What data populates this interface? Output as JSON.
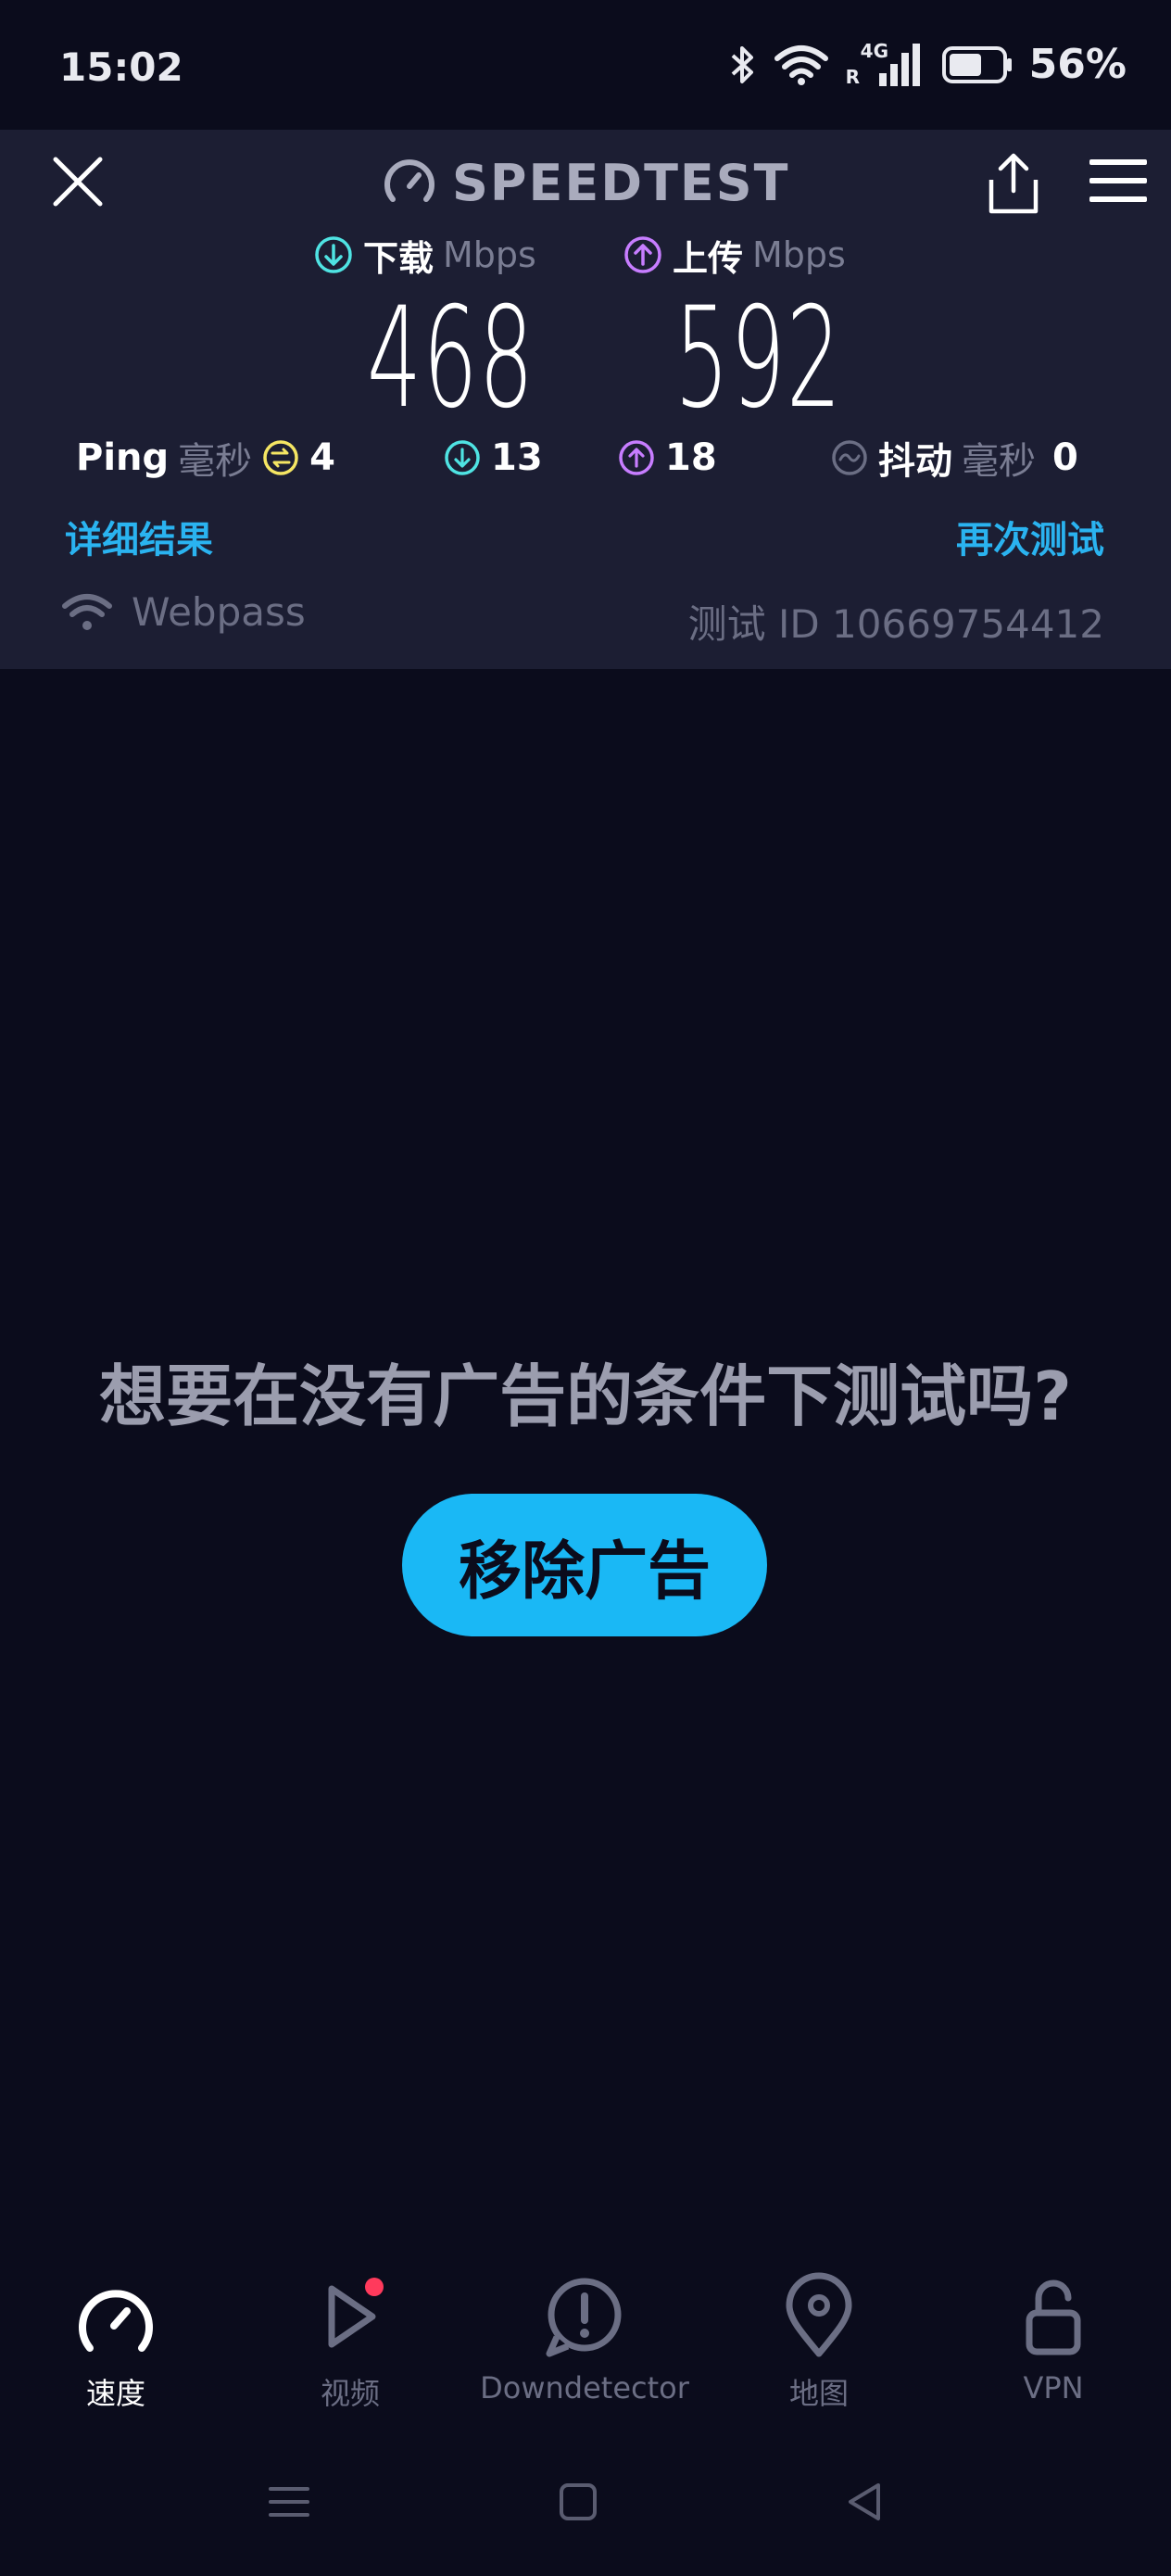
{
  "status_bar": {
    "time": "15:02",
    "network_label": "4G",
    "roaming_label": "R",
    "battery": "56%",
    "icons": [
      "bluetooth-icon",
      "wifi-icon",
      "cellular-signal-icon",
      "battery-icon"
    ]
  },
  "header": {
    "brand": "SPEEDTEST",
    "icons": [
      "close-icon",
      "speedometer-icon",
      "share-icon",
      "menu-icon"
    ]
  },
  "results": {
    "download": {
      "label": "下载",
      "unit": "Mbps",
      "value": "468",
      "color": "#4fe3e3"
    },
    "upload": {
      "label": "上传",
      "unit": "Mbps",
      "value": "592",
      "color": "#c77dff"
    },
    "ping": {
      "label": "Ping",
      "unit": "毫秒",
      "value": "4",
      "color": "#f5e663"
    },
    "download_latency": {
      "value": "13"
    },
    "upload_latency": {
      "value": "18"
    },
    "jitter": {
      "label": "抖动",
      "unit": "毫秒",
      "value": "0"
    },
    "detail_link": "详细结果",
    "retest_link": "再次测试",
    "provider": "Webpass",
    "test_id": "测试 ID 10669754412",
    "link_color": "#2ab3f0"
  },
  "ad": {
    "prompt": "想要在没有广告的条件下测试吗?",
    "button": "移除广告",
    "button_color": "#1ab8f5"
  },
  "bottom_nav": {
    "items": [
      {
        "label": "速度",
        "icon": "speedometer-icon",
        "active": true
      },
      {
        "label": "视频",
        "icon": "play-icon",
        "active": false,
        "badge": true
      },
      {
        "label": "Downdetector",
        "icon": "alert-icon",
        "active": false
      },
      {
        "label": "地图",
        "icon": "map-pin-icon",
        "active": false
      },
      {
        "label": "VPN",
        "icon": "unlock-icon",
        "active": false
      }
    ]
  },
  "system_nav": {
    "icons": [
      "recents-icon",
      "home-icon",
      "back-icon"
    ]
  }
}
